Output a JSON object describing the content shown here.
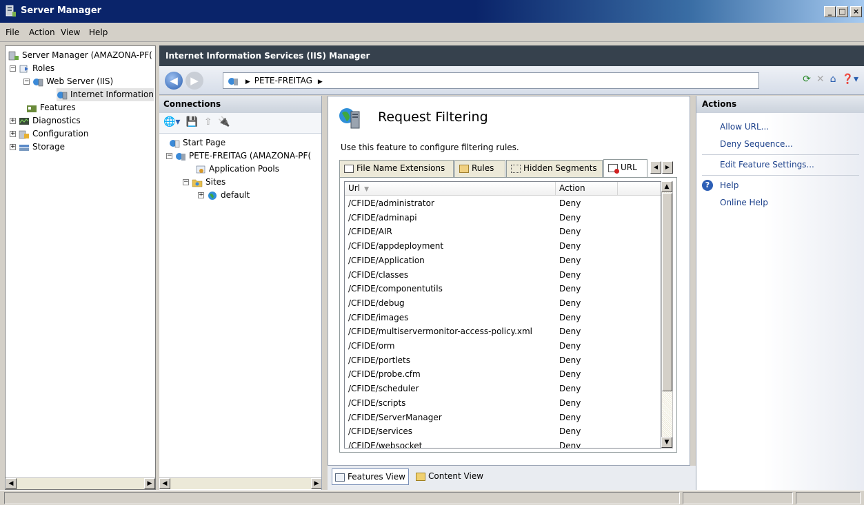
{
  "window": {
    "title": "Server Manager",
    "controls": {
      "minimize": "_",
      "maximize": "□",
      "close": "×"
    }
  },
  "menu": [
    "File",
    "Action",
    "View",
    "Help"
  ],
  "tree": {
    "root": "Server Manager (AMAZONA-PF(",
    "roles": "Roles",
    "web_server": "Web Server (IIS)",
    "iis": "Internet Information",
    "features": "Features",
    "diagnostics": "Diagnostics",
    "configuration": "Configuration",
    "storage": "Storage"
  },
  "iis": {
    "header": "Internet Information Services (IIS) Manager",
    "address": "PETE-FREITAG",
    "connections": {
      "title": "Connections",
      "start_page": "Start Page",
      "server": "PETE-FREITAG (AMAZONA-PF(",
      "app_pools": "Application Pools",
      "sites": "Sites",
      "default_site": "default"
    },
    "feature": {
      "title": "Request Filtering",
      "description": "Use this feature to configure filtering rules.",
      "tabs": [
        "File Name Extensions",
        "Rules",
        "Hidden Segments",
        "URL"
      ],
      "active_tab": "URL",
      "columns": {
        "url": "Url",
        "action": "Action"
      },
      "rows": [
        {
          "url": "/CFIDE/administrator",
          "action": "Deny"
        },
        {
          "url": "/CFIDE/adminapi",
          "action": "Deny"
        },
        {
          "url": "/CFIDE/AIR",
          "action": "Deny"
        },
        {
          "url": "/CFIDE/appdeployment",
          "action": "Deny"
        },
        {
          "url": "/CFIDE/Application",
          "action": "Deny"
        },
        {
          "url": "/CFIDE/classes",
          "action": "Deny"
        },
        {
          "url": "/CFIDE/componentutils",
          "action": "Deny"
        },
        {
          "url": "/CFIDE/debug",
          "action": "Deny"
        },
        {
          "url": "/CFIDE/images",
          "action": "Deny"
        },
        {
          "url": "/CFIDE/multiservermonitor-access-policy.xml",
          "action": "Deny"
        },
        {
          "url": "/CFIDE/orm",
          "action": "Deny"
        },
        {
          "url": "/CFIDE/portlets",
          "action": "Deny"
        },
        {
          "url": "/CFIDE/probe.cfm",
          "action": "Deny"
        },
        {
          "url": "/CFIDE/scheduler",
          "action": "Deny"
        },
        {
          "url": "/CFIDE/scripts",
          "action": "Deny"
        },
        {
          "url": "/CFIDE/ServerManager",
          "action": "Deny"
        },
        {
          "url": "/CFIDE/services",
          "action": "Deny"
        },
        {
          "url": "/CFIDE/websocket",
          "action": "Deny"
        }
      ]
    },
    "views": {
      "features": "Features View",
      "content": "Content View",
      "active": "features"
    },
    "actions": {
      "title": "Actions",
      "allow_url": "Allow URL...",
      "deny_sequence": "Deny Sequence...",
      "edit_settings": "Edit Feature Settings...",
      "help": "Help",
      "online_help": "Online Help"
    }
  },
  "colors": {
    "title_bar": "#0a246a",
    "iis_header": "#36414d",
    "link": "#1a3f8a"
  }
}
